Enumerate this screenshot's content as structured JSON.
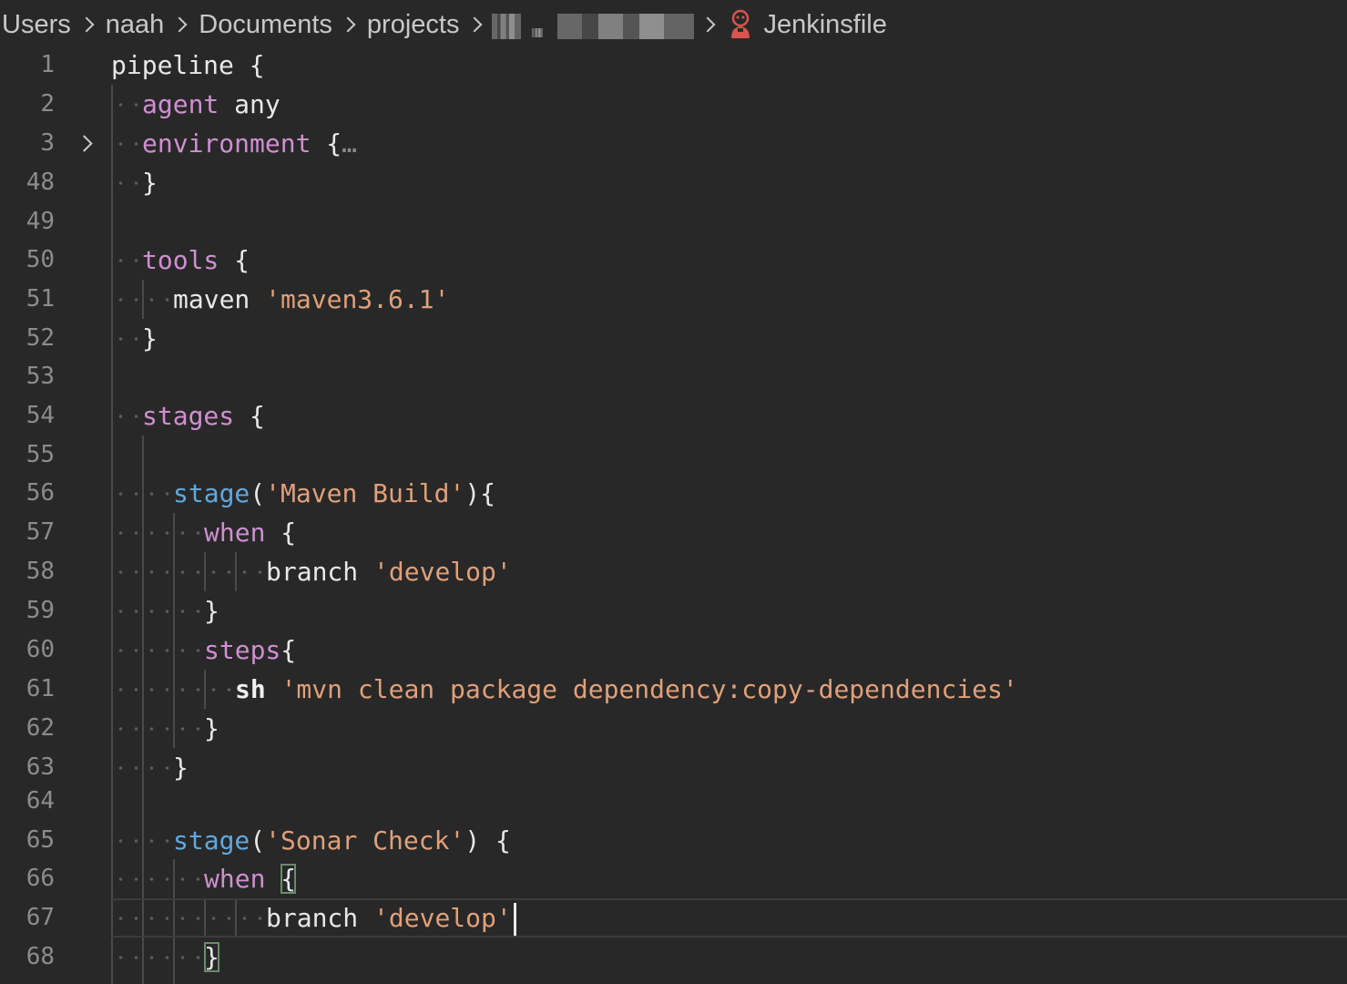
{
  "breadcrumb": {
    "items": [
      "Users",
      "naah",
      "Documents",
      "projects"
    ],
    "file": "Jenkinsfile",
    "file_icon": "jenkins-icon"
  },
  "lines": [
    {
      "num": "1",
      "text": "pipeline {"
    },
    {
      "num": "2",
      "text": "agent any"
    },
    {
      "num": "3",
      "text": "environment {…"
    },
    {
      "num": "48",
      "text": "}"
    },
    {
      "num": "49",
      "text": ""
    },
    {
      "num": "50",
      "text": "tools {"
    },
    {
      "num": "51",
      "text": "maven 'maven3.6.1'"
    },
    {
      "num": "52",
      "text": "}"
    },
    {
      "num": "53",
      "text": ""
    },
    {
      "num": "54",
      "text": "stages {"
    },
    {
      "num": "55",
      "text": ""
    },
    {
      "num": "56",
      "text": "stage('Maven Build'){"
    },
    {
      "num": "57",
      "text": "when {"
    },
    {
      "num": "58",
      "text": "branch 'develop'"
    },
    {
      "num": "59",
      "text": "}"
    },
    {
      "num": "60",
      "text": "steps{"
    },
    {
      "num": "61",
      "text": "sh 'mvn clean package dependency:copy-dependencies'"
    },
    {
      "num": "62",
      "text": "}"
    },
    {
      "num": "63",
      "text": "}"
    },
    {
      "num": "64",
      "text": ""
    },
    {
      "num": "65",
      "text": "stage('Sonar Check') {"
    },
    {
      "num": "66",
      "text": "when {"
    },
    {
      "num": "67",
      "text": "branch 'develop'"
    },
    {
      "num": "68",
      "text": "}"
    }
  ],
  "tokens": {
    "pipeline": "pipeline",
    "agent": "agent",
    "any": "any",
    "environment": "environment",
    "ellipsis": "…",
    "tools": "tools",
    "maven": "maven",
    "maven_ver": "'maven3.6.1'",
    "stages": "stages",
    "stage": "stage",
    "maven_build": "'Maven Build'",
    "when": "when",
    "branch": "branch",
    "develop": "'develop'",
    "steps": "steps",
    "sh": "sh",
    "mvn_cmd": "'mvn clean package dependency:copy-dependencies'",
    "sonar_check": "'Sonar Check'",
    "open_brace": "{",
    "close_brace": "}",
    "open_paren": "(",
    "close_paren": ")"
  },
  "colors": {
    "keyword": "#cf8fd0",
    "function": "#5fa8e0",
    "string": "#e0a07a",
    "plain": "#e8e8e8",
    "background": "#282828",
    "line_number": "#8c8c8c"
  }
}
